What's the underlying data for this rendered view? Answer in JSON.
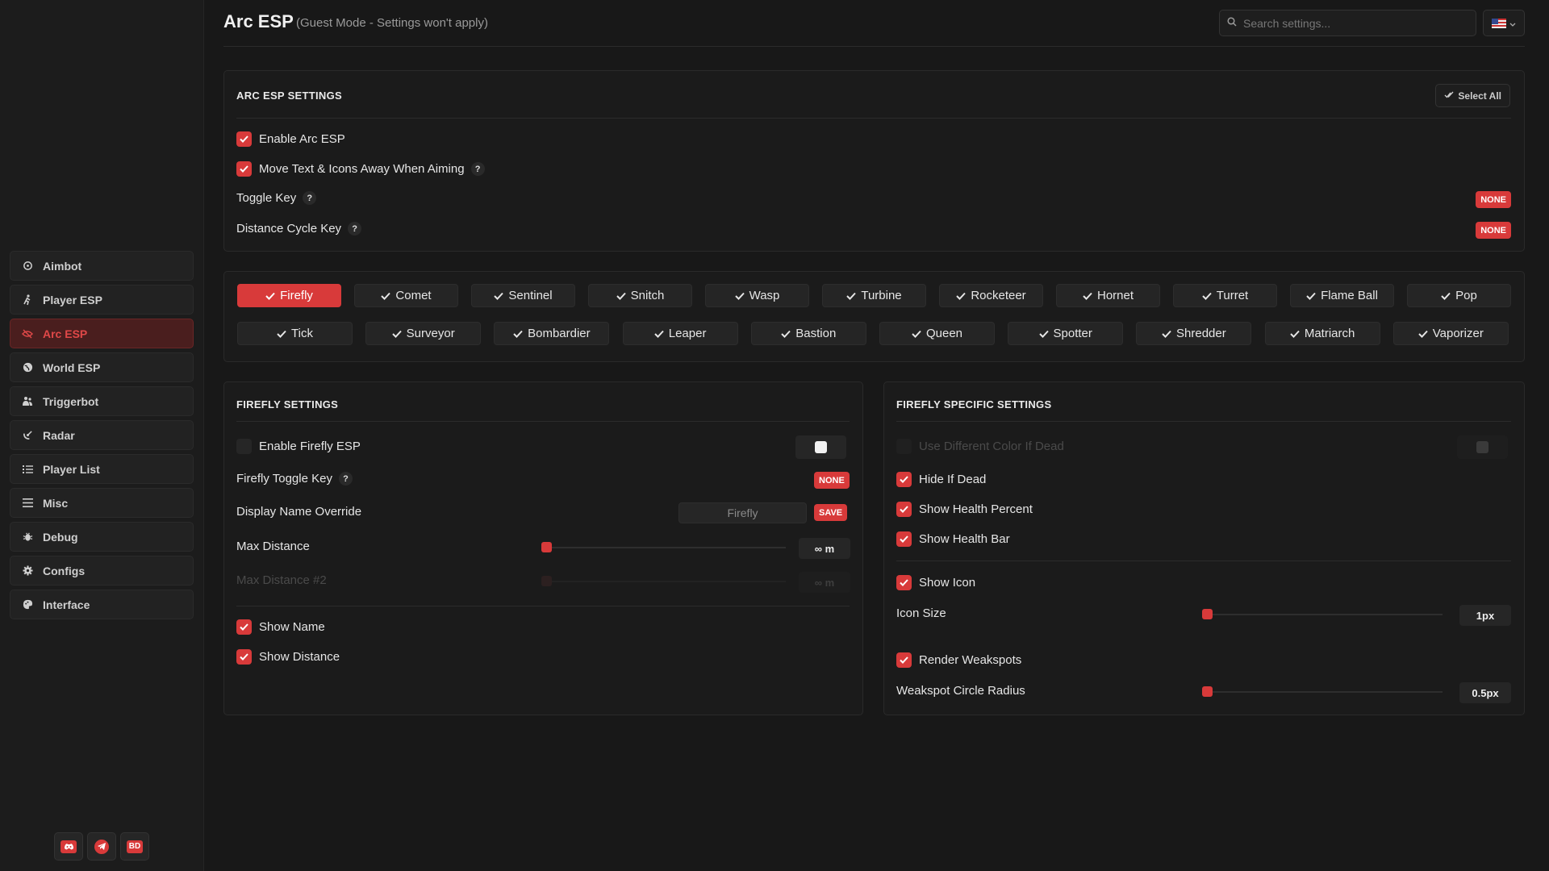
{
  "header": {
    "title": "Arc ESP",
    "subtitle": "(Guest Mode - Settings won't apply)",
    "search_placeholder": "Search settings...",
    "search_icon": "search-icon",
    "language_flag": "us-flag-icon"
  },
  "sidebar": {
    "items": [
      {
        "label": "Aimbot",
        "icon": "crosshair-icon"
      },
      {
        "label": "Player ESP",
        "icon": "running-person-icon"
      },
      {
        "label": "Arc ESP",
        "icon": "eye-slash-icon",
        "active": true
      },
      {
        "label": "World ESP",
        "icon": "globe-icon"
      },
      {
        "label": "Triggerbot",
        "icon": "people-icon"
      },
      {
        "label": "Radar",
        "icon": "radar-icon"
      },
      {
        "label": "Player List",
        "icon": "list-icon"
      },
      {
        "label": "Misc",
        "icon": "menu-icon"
      },
      {
        "label": "Debug",
        "icon": "bug-icon"
      },
      {
        "label": "Configs",
        "icon": "gear-icon"
      },
      {
        "label": "Interface",
        "icon": "palette-icon"
      }
    ],
    "social": [
      {
        "icon": "discord-icon",
        "text": ""
      },
      {
        "icon": "telegram-icon",
        "text": ""
      },
      {
        "icon": "bd-icon",
        "text": "BD"
      }
    ]
  },
  "arc_settings": {
    "title": "ARC ESP SETTINGS",
    "select_all": "Select All",
    "enable_label": "Enable Arc ESP",
    "move_text_label": "Move Text & Icons Away When Aiming",
    "toggle_key_label": "Toggle Key",
    "toggle_key_value": "NONE",
    "distance_cycle_label": "Distance Cycle Key",
    "distance_cycle_value": "NONE",
    "help": "?"
  },
  "targets": {
    "row1": [
      "Firefly",
      "Comet",
      "Sentinel",
      "Snitch",
      "Wasp",
      "Turbine",
      "Rocketeer",
      "Hornet",
      "Turret",
      "Flame Ball",
      "Pop"
    ],
    "row2": [
      "Tick",
      "Surveyor",
      "Bombardier",
      "Leaper",
      "Bastion",
      "Queen",
      "Spotter",
      "Shredder",
      "Matriarch",
      "Vaporizer"
    ],
    "active": "Firefly"
  },
  "firefly_settings": {
    "title": "FIREFLY SETTINGS",
    "enable_label": "Enable Firefly ESP",
    "toggle_key_label": "Firefly Toggle Key",
    "toggle_key_value": "NONE",
    "display_name_label": "Display Name Override",
    "display_name_value": "Firefly",
    "save_label": "SAVE",
    "max_distance_label": "Max Distance",
    "max_distance_value": "∞ m",
    "max_distance2_label": "Max Distance #2",
    "max_distance2_value": "∞ m",
    "show_name_label": "Show Name",
    "show_distance_label": "Show Distance"
  },
  "firefly_specific": {
    "title": "FIREFLY SPECIFIC SETTINGS",
    "diff_color_label": "Use Different Color If Dead",
    "hide_dead_label": "Hide If Dead",
    "health_percent_label": "Show Health Percent",
    "health_bar_label": "Show Health Bar",
    "show_icon_label": "Show Icon",
    "icon_size_label": "Icon Size",
    "icon_size_value": "1px",
    "render_weakspots_label": "Render Weakspots",
    "weakspot_radius_label": "Weakspot Circle Radius",
    "weakspot_radius_value": "0.5px"
  },
  "colors": {
    "accent": "#d83a3a",
    "background": "#181818",
    "panel": "#1b1b1b"
  }
}
